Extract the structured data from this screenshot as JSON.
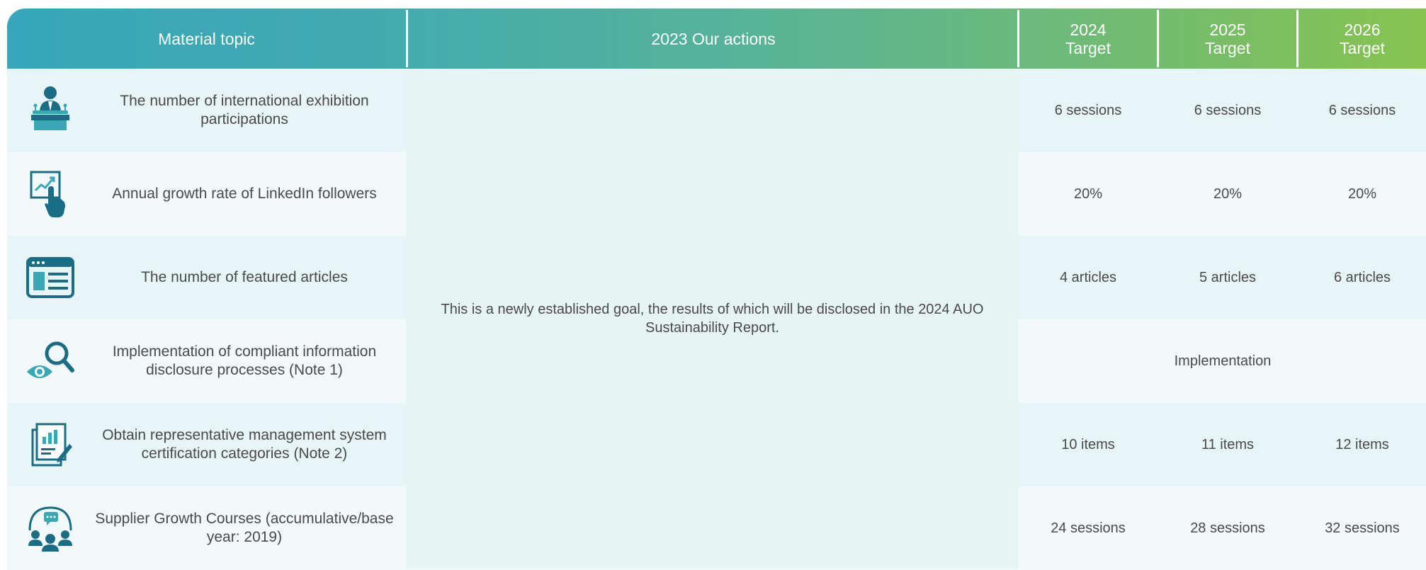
{
  "header": {
    "topic": "Material topic",
    "actions": "2023 Our actions",
    "y2024": [
      "2024",
      "Target"
    ],
    "y2025": [
      "2025",
      "Target"
    ],
    "y2026": [
      "2026",
      "Target"
    ]
  },
  "actions_text": "This is a newly established goal, the results of which will be disclosed in the 2024 AUO Sustainability Report.",
  "rows": [
    {
      "icon": "podium-speaker-icon",
      "topic": "The number of international exhibition participations",
      "t2024": "6 sessions",
      "t2025": "6 sessions",
      "t2026": "6 sessions"
    },
    {
      "icon": "touch-chart-icon",
      "topic": "Annual growth rate of LinkedIn followers",
      "t2024": "20%",
      "t2025": "20%",
      "t2026": "20%"
    },
    {
      "icon": "browser-article-icon",
      "topic": "The number of featured articles",
      "t2024": "4 articles",
      "t2025": "5 articles",
      "t2026": "6 articles"
    },
    {
      "icon": "eye-magnifier-icon",
      "topic": "Implementation of compliant information disclosure processes (Note 1)",
      "merged": "Implementation"
    },
    {
      "icon": "document-chart-pen-icon",
      "topic": "Obtain representative management system certification categories (Note 2)",
      "t2024": "10 items",
      "t2025": "11 items",
      "t2026": "12 items"
    },
    {
      "icon": "group-chat-icon",
      "topic": "Supplier Growth Courses (accumulative/base year: 2019)",
      "t2024": "24 sessions",
      "t2025": "28 sessions",
      "t2026": "32 sessions"
    }
  ],
  "colors": {
    "teal": "#1a6d84",
    "icon_light": "#3aa7b6",
    "header_start": "#37a6ba",
    "header_end": "#86c34f"
  }
}
